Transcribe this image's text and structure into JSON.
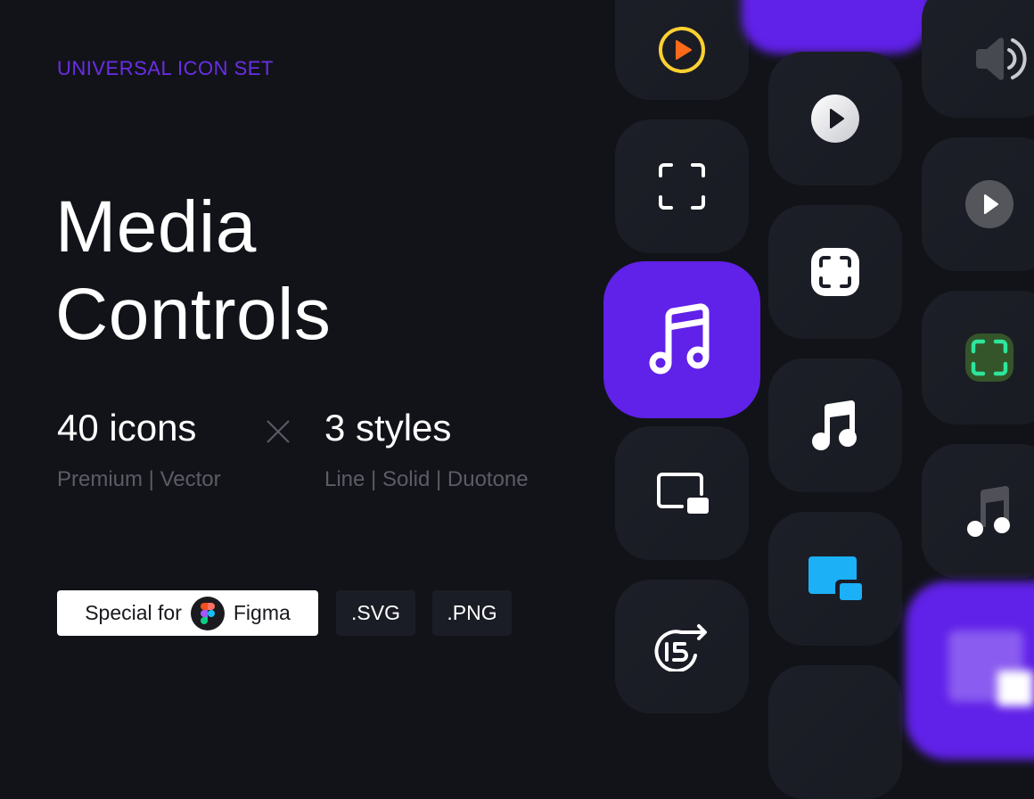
{
  "hero": {
    "eyebrow": "UNIVERSAL ICON SET",
    "title_line1": "Media",
    "title_line2": "Controls",
    "icons_count": "40 icons",
    "icons_sub": "Premium | Vector",
    "styles_count": "3 styles",
    "styles_sub": "Line | Solid | Duotone",
    "times_icon": "multiply-icon"
  },
  "badges": {
    "figma_prefix": "Special for",
    "figma_label": "Figma",
    "svg_label": ".SVG",
    "png_label": ".PNG"
  },
  "colors": {
    "background": "#121319",
    "accent_purple": "#6021e8",
    "eyebrow": "#6a2ee8",
    "muted_text": "#5b5d66",
    "tile": "#1b1d26",
    "play_yellow": "#fdd130",
    "play_orange": "#ff6a1a",
    "pip_blue": "#1cb0f6",
    "focus_green": "#2ee59d",
    "focus_green_bg": "#34552a"
  },
  "icon_grid": {
    "column1": [
      "play-circle-duotone-icon",
      "focus-frame-line-icon",
      "music-note-line-icon",
      "picture-in-picture-line-icon",
      "forward-15-icon"
    ],
    "column2": [
      "play-circle-solid-icon",
      "focus-frame-solid-icon",
      "music-note-solid-icon",
      "picture-in-picture-duotone-icon"
    ],
    "column3": [
      "volume-icon",
      "play-circle-gray-icon",
      "focus-frame-duotone-icon",
      "music-note-duotone-icon"
    ]
  }
}
